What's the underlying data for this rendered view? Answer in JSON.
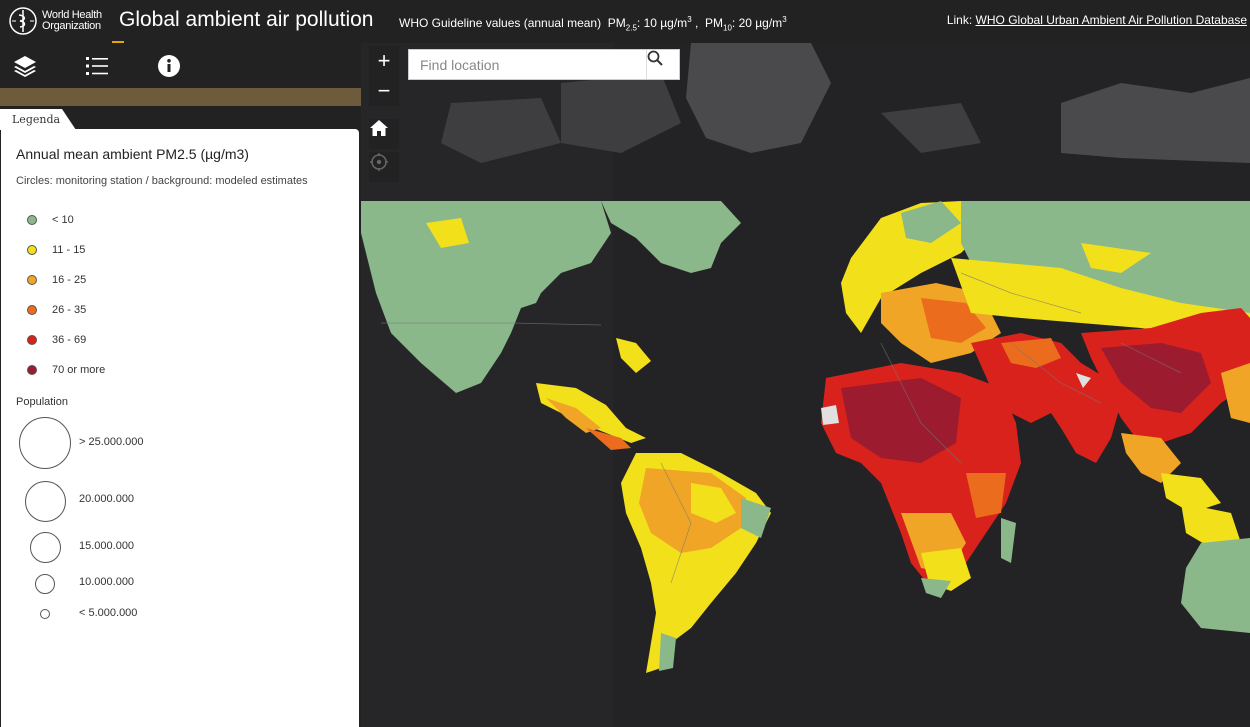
{
  "header": {
    "logo_line1": "World Health",
    "logo_line2": "Organization",
    "title": "Global ambient air pollution",
    "guideline_prefix": "WHO Guideline values (annual mean)",
    "pm25_label": "PM",
    "pm25_sub": "2.5",
    "pm25_value": ": 10 µg/m",
    "pm25_unit_sup": "3",
    "separator": " , ",
    "pm10_label": "PM",
    "pm10_sub": "10",
    "pm10_value": ": 20 µg/m",
    "pm10_unit_sup": "3",
    "link_prefix": "Link:",
    "link_text": "WHO Global Urban Ambient Air Pollution Database"
  },
  "toolbar": {
    "layers_icon": "layers-icon",
    "legend_icon": "list-icon",
    "info_icon": "info-icon"
  },
  "legend": {
    "tab": "Legenda",
    "title": "Annual mean ambient PM2.5 (µg/m3)",
    "subtitle": "Circles: monitoring station / background: modeled estimates",
    "classes": [
      {
        "label": "< 10",
        "color": "#8bb88b"
      },
      {
        "label": "11 - 15",
        "color": "#f2e01a"
      },
      {
        "label": "16 - 25",
        "color": "#f0a526"
      },
      {
        "label": "26 - 35",
        "color": "#ec6c1e"
      },
      {
        "label": "36 - 69",
        "color": "#d9221c"
      },
      {
        "label": "70 or more",
        "color": "#9c1b2e"
      }
    ],
    "population_label": "Population",
    "population": [
      {
        "label": "> 25.000.000"
      },
      {
        "label": "20.000.000"
      },
      {
        "label": "15.000.000"
      },
      {
        "label": "10.000.000"
      },
      {
        "label": "< 5.000.000"
      }
    ]
  },
  "map": {
    "zoom_in": "+",
    "zoom_out": "−",
    "search_placeholder": "Find location",
    "home_icon": "home-icon",
    "locate_icon": "locate-icon",
    "search_icon": "search-icon"
  }
}
